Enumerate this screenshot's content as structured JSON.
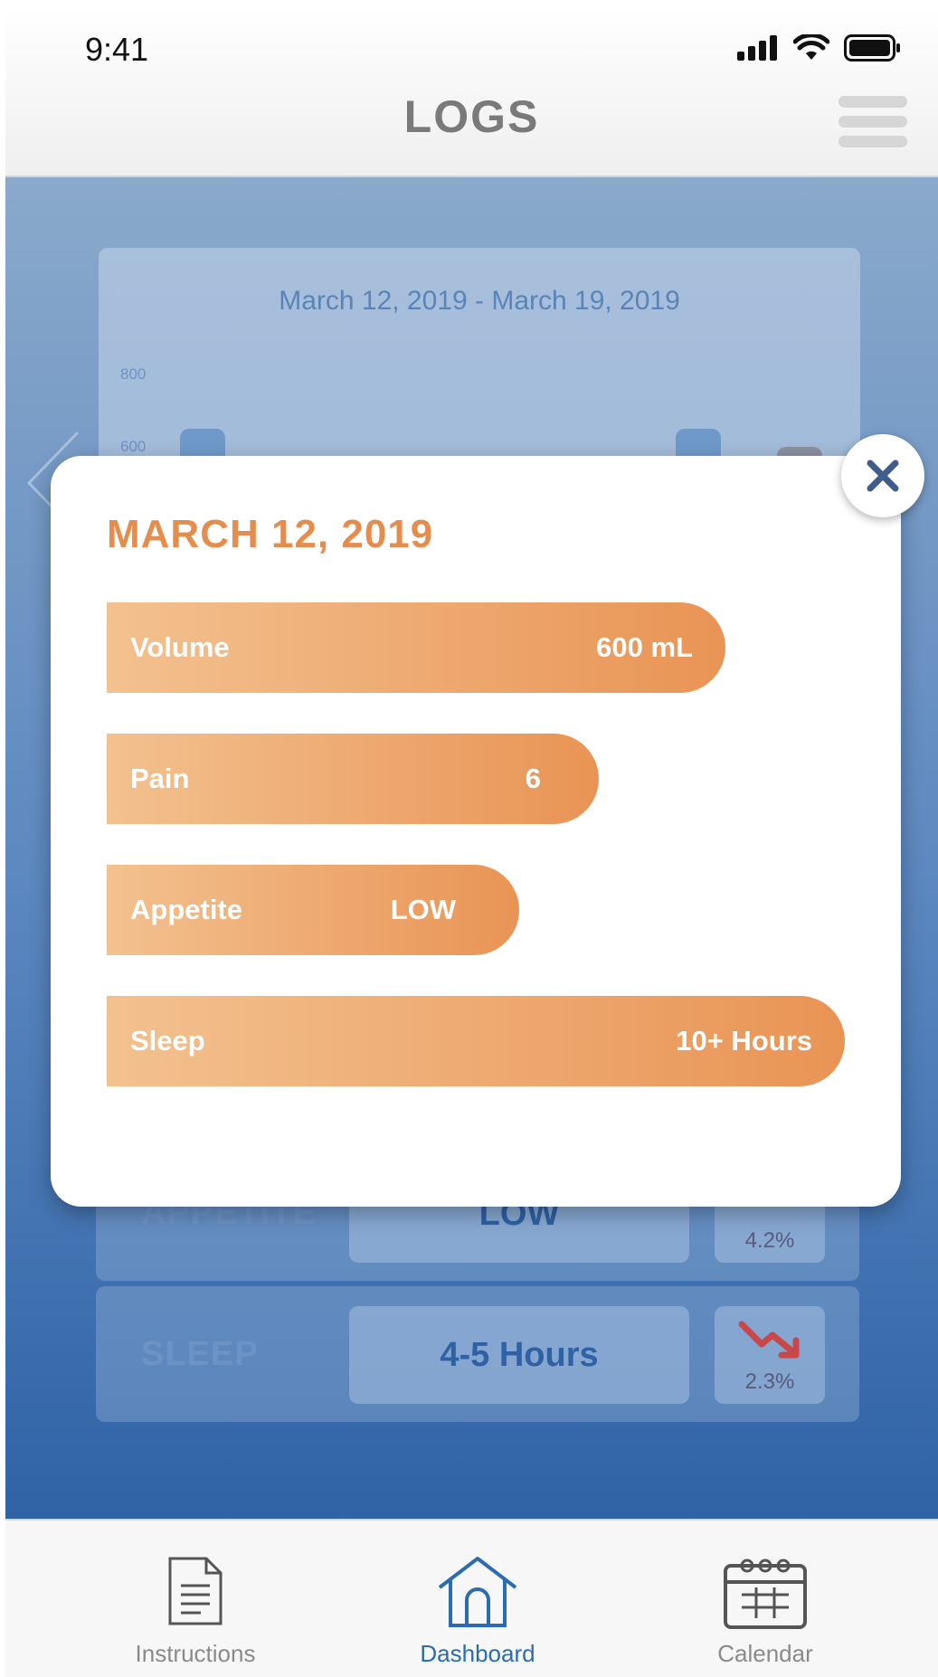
{
  "status_bar": {
    "time": "9:41"
  },
  "header": {
    "title": "LOGS"
  },
  "chart": {
    "date_range": "March 12, 2019 - March 19, 2019",
    "y_ticks": [
      "800",
      "600"
    ]
  },
  "metrics": {
    "appetite": {
      "label": "APPETITE",
      "value": "LOW",
      "change": "4.2%"
    },
    "sleep": {
      "label": "SLEEP",
      "value": "4-5 Hours",
      "change": "2.3%"
    }
  },
  "modal": {
    "title": "MARCH 12, 2019",
    "bars": [
      {
        "label": "Volume",
        "value": "600 mL",
        "fill": 0.84
      },
      {
        "label": "Pain",
        "value": "6",
        "fill": 0.67
      },
      {
        "label": "Appetite",
        "value": "LOW",
        "fill": 0.56
      },
      {
        "label": "Sleep",
        "value": "10+ Hours",
        "fill": 1.0
      }
    ]
  },
  "tabs": [
    {
      "label": "Instructions",
      "icon": "document-icon",
      "active": false
    },
    {
      "label": "Dashboard",
      "icon": "home-icon",
      "active": true
    },
    {
      "label": "Calendar",
      "icon": "calendar-icon",
      "active": false
    }
  ],
  "colors": {
    "accent_orange": "#e58d4d",
    "tab_active": "#2b6cb0"
  }
}
